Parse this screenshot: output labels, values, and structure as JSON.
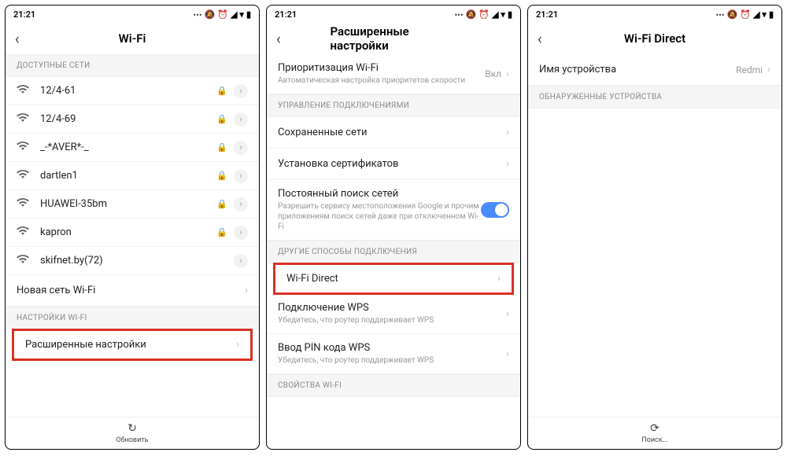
{
  "status_time": "21:21",
  "screen1": {
    "title": "Wi-Fi",
    "section_available": "ДОСТУПНЫЕ СЕТИ",
    "networks": [
      {
        "name": "12/4-61",
        "locked": true
      },
      {
        "name": "12/4-69",
        "locked": true
      },
      {
        "name": "_-*AVER*-_",
        "locked": true
      },
      {
        "name": "dartlen1",
        "locked": true
      },
      {
        "name": "HUAWEI-35bm",
        "locked": true
      },
      {
        "name": "kapron",
        "locked": true
      },
      {
        "name": "skifnet.by(72)",
        "locked": false
      }
    ],
    "new_network": "Новая сеть Wi-Fi",
    "section_settings": "НАСТРОЙКИ WI-FI",
    "advanced": "Расширенные настройки",
    "refresh": "Обновить"
  },
  "screen2": {
    "title": "Расширенные настройки",
    "priority_title": "Приоритизация Wi-Fi",
    "priority_sub": "Автоматическая настройка приоритетов скорости",
    "priority_value": "Вкл",
    "section_conn": "УПРАВЛЕНИЕ ПОДКЛЮЧЕНИЯМИ",
    "saved_networks": "Сохраненные сети",
    "certs": "Установка сертификатов",
    "scan_title": "Постоянный поиск сетей",
    "scan_sub": "Разрешить сервису местоположения Google и прочим приложениям поиск сетей даже при отключенном Wi-Fi",
    "section_other": "ДРУГИЕ СПОСОБЫ ПОДКЛЮЧЕНИЯ",
    "wifi_direct": "Wi-Fi Direct",
    "wps_title": "Подключение WPS",
    "wps_sub": "Убедитесь, что роутер поддерживает WPS",
    "wps_pin_title": "Ввод PIN кода WPS",
    "wps_pin_sub": "Убедитесь, что роутер поддерживает WPS",
    "section_props": "СВОЙСТВА WI-FI"
  },
  "screen3": {
    "title": "Wi-Fi Direct",
    "device_name_label": "Имя устройства",
    "device_name_value": "Redmi",
    "section_found": "ОБНАРУЖЕННЫЕ УСТРОЙСТВА",
    "search": "Поиск..."
  }
}
